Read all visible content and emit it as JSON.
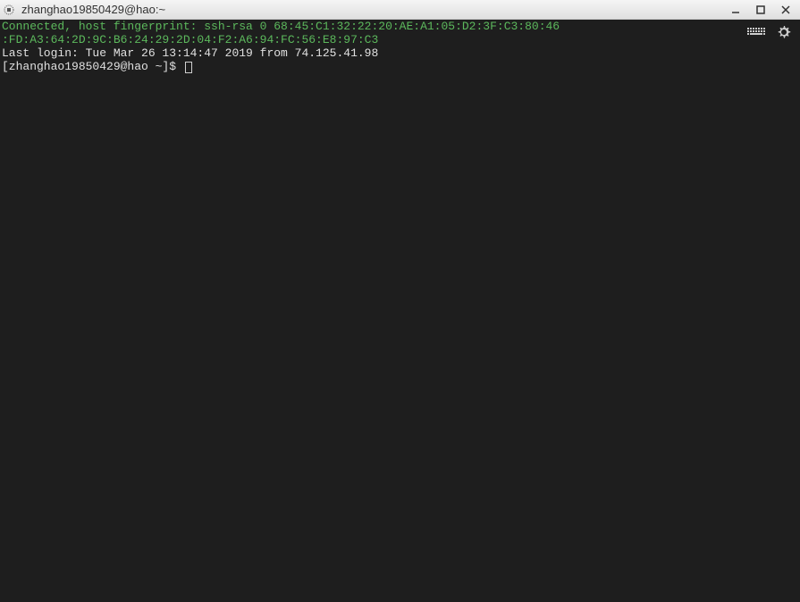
{
  "window": {
    "title": "zhanghao19850429@hao:~"
  },
  "terminal": {
    "line1": "Connected, host fingerprint: ssh-rsa 0 68:45:C1:32:22:20:AE:A1:05:D2:3F:C3:80:46",
    "line2": ":FD:A3:64:2D:9C:B6:24:29:2D:04:F2:A6:94:FC:56:E8:97:C3",
    "line3": "Last login: Tue Mar 26 13:14:47 2019 from 74.125.41.98",
    "prompt": "[zhanghao19850429@hao ~]$ "
  }
}
